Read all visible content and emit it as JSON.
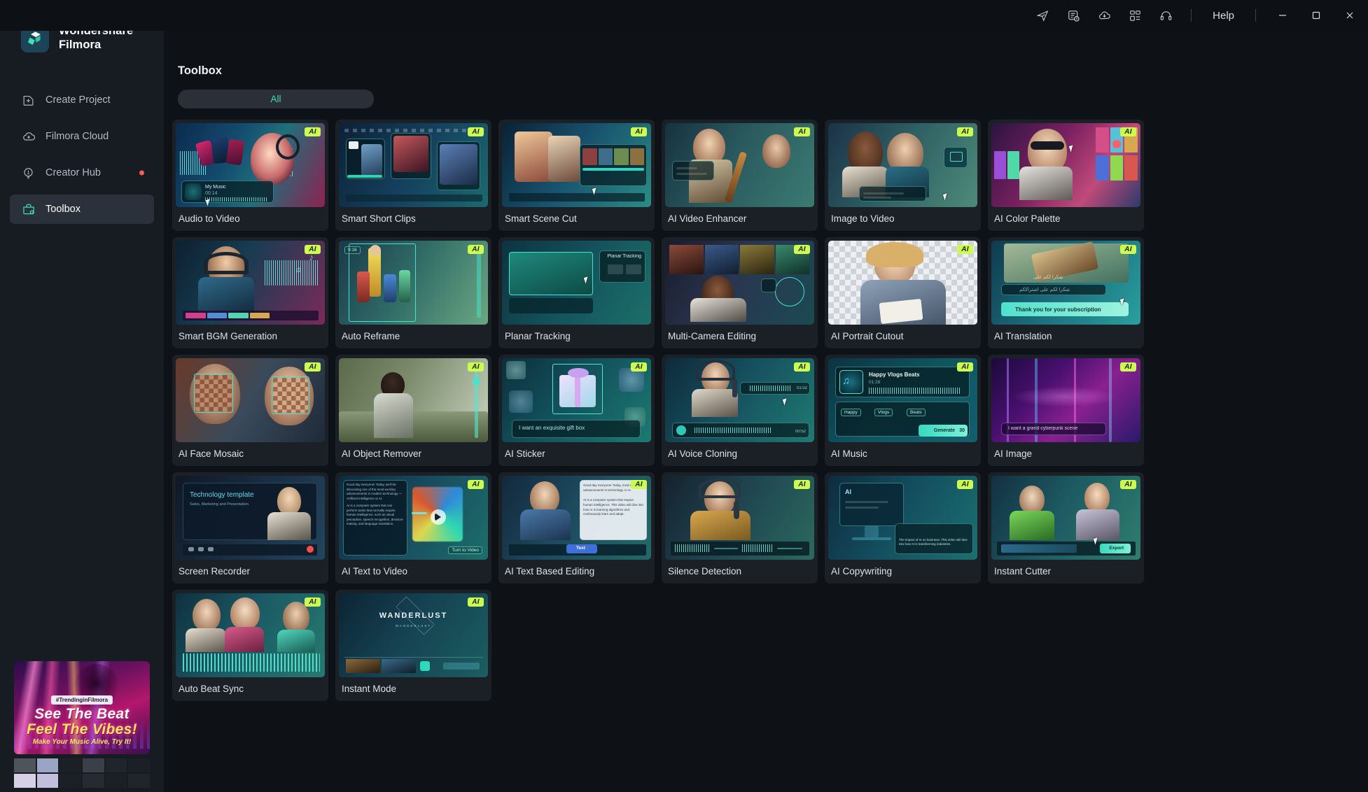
{
  "window": {
    "title": "Wondershare Filmora",
    "titlebar_icons": [
      {
        "name": "send-share-icon",
        "glyph": "send"
      },
      {
        "name": "task-list-icon",
        "glyph": "tasks"
      },
      {
        "name": "cloud-download-icon",
        "glyph": "cloud"
      },
      {
        "name": "apps-grid-icon",
        "glyph": "grid"
      },
      {
        "name": "support-headset-icon",
        "glyph": "headset"
      }
    ],
    "help_label": "Help",
    "controls": {
      "minimize": "minimize-button",
      "maximize": "maximize-button",
      "close": "close-button"
    }
  },
  "brand": {
    "line1": "Wondershare",
    "line2": "Filmora",
    "logo_name": "filmora-logo"
  },
  "sidebar": {
    "items": [
      {
        "label": "Create Project",
        "icon": "create-project-icon",
        "active": false,
        "badge": false
      },
      {
        "label": "Filmora Cloud",
        "icon": "cloud-icon",
        "active": false,
        "badge": false
      },
      {
        "label": "Creator Hub",
        "icon": "lightbulb-icon",
        "active": false,
        "badge": true
      },
      {
        "label": "Toolbox",
        "icon": "toolbox-icon",
        "active": true,
        "badge": false
      }
    ],
    "promo": {
      "tag": "#TrendinginFilmora",
      "line1": "See The Beat",
      "line2": "Feel The Vibes!",
      "line3": "Make Your Music Alive, Try It!"
    }
  },
  "main": {
    "page_title": "Toolbox",
    "tabs": [
      {
        "label": "All",
        "active": true
      }
    ],
    "ai_badge_label": "AI",
    "cards": [
      {
        "label": "Audio to Video",
        "ai": true,
        "art": "audio-to-video"
      },
      {
        "label": "Smart Short Clips",
        "ai": true,
        "art": "smart-short-clips"
      },
      {
        "label": "Smart Scene Cut",
        "ai": true,
        "art": "smart-scene-cut"
      },
      {
        "label": "AI Video Enhancer",
        "ai": true,
        "art": "ai-video-enhancer"
      },
      {
        "label": "Image to Video",
        "ai": true,
        "art": "image-to-video"
      },
      {
        "label": "AI Color Palette",
        "ai": true,
        "art": "ai-color-palette"
      },
      {
        "label": "Smart BGM Generation",
        "ai": true,
        "art": "smart-bgm-generation"
      },
      {
        "label": "Auto Reframe",
        "ai": true,
        "art": "auto-reframe"
      },
      {
        "label": "Planar Tracking",
        "ai": false,
        "art": "planar-tracking"
      },
      {
        "label": "Multi-Camera Editing",
        "ai": true,
        "art": "multi-camera-editing"
      },
      {
        "label": "AI Portrait Cutout",
        "ai": true,
        "art": "ai-portrait-cutout"
      },
      {
        "label": "AI Translation",
        "ai": true,
        "art": "ai-translation"
      },
      {
        "label": "AI Face Mosaic",
        "ai": true,
        "art": "ai-face-mosaic"
      },
      {
        "label": "AI Object Remover",
        "ai": true,
        "art": "ai-object-remover"
      },
      {
        "label": "AI Sticker",
        "ai": true,
        "art": "ai-sticker"
      },
      {
        "label": "AI Voice Cloning",
        "ai": true,
        "art": "ai-voice-cloning"
      },
      {
        "label": "AI Music",
        "ai": true,
        "art": "ai-music"
      },
      {
        "label": "AI Image",
        "ai": true,
        "art": "ai-image"
      },
      {
        "label": "Screen Recorder",
        "ai": false,
        "art": "screen-recorder"
      },
      {
        "label": "AI Text to Video",
        "ai": true,
        "art": "ai-text-to-video"
      },
      {
        "label": "AI Text Based Editing",
        "ai": true,
        "art": "ai-text-based-editing"
      },
      {
        "label": "Silence Detection",
        "ai": true,
        "art": "silence-detection"
      },
      {
        "label": "AI Copywriting",
        "ai": true,
        "art": "ai-copywriting"
      },
      {
        "label": "Instant Cutter",
        "ai": true,
        "art": "instant-cutter"
      },
      {
        "label": "Auto Beat Sync",
        "ai": true,
        "art": "auto-beat-sync"
      },
      {
        "label": "Instant Mode",
        "ai": true,
        "art": "instant-mode"
      }
    ],
    "thumb_text": {
      "audio_to_video_track": "My Music",
      "audio_to_video_time": "00:14",
      "ai_sticker_prompt": "I want an exquisite gift box",
      "ai_translation_caption": "Thank you for your subscription",
      "ai_music_title": "Happy Vlogs Beats",
      "ai_music_time": "01:28",
      "ai_music_tags": [
        "Happy",
        "Vlogs",
        "Beats"
      ],
      "ai_music_generate": "Generate",
      "ai_music_credits": "30",
      "ai_image_prompt": "I want a grand cyberpunk scene",
      "ai_voice_time_1": "01:02",
      "ai_voice_time_2": "00:52",
      "screen_recorder_title": "Technology template",
      "screen_recorder_sub": "Sales, Marketing and Presentation",
      "ai_text_to_video_cta": "Turn to Video",
      "ai_text_based_editing_chip": "Text",
      "instant_cutter_export": "Export",
      "instant_mode_title": "WANDERLUST",
      "instant_mode_sub": "WANDERLUST",
      "planar_tracking_panel": "Planar Tracking",
      "ai_copywriting_body": "The impact of AI on business: This video will dive into how AI is transforming industries."
    }
  },
  "colors": {
    "accent": "#3fdcb4",
    "ai_badge_bg": "#cdfb4f",
    "badge_dot": "#ff5b5b",
    "card_bg": "#1b2027",
    "sidebar_bg": "#171b22",
    "main_bg": "#0e1116",
    "titlebar_bg": "#0d1116"
  }
}
